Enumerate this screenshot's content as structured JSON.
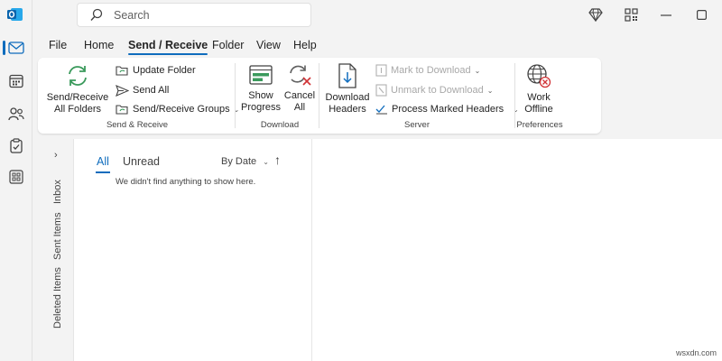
{
  "search": {
    "placeholder": "Search"
  },
  "menu": {
    "tabs": [
      {
        "label": "File"
      },
      {
        "label": "Home"
      },
      {
        "label": "Send / Receive",
        "active": true
      },
      {
        "label": "Folder"
      },
      {
        "label": "View"
      },
      {
        "label": "Help"
      }
    ]
  },
  "ribbon": {
    "send_receive": {
      "all_folders_line1": "Send/Receive",
      "all_folders_line2": "All Folders",
      "update_folder": "Update Folder",
      "send_all": "Send All",
      "groups": "Send/Receive Groups",
      "group_label": "Send & Receive"
    },
    "download": {
      "show_progress_line1": "Show",
      "show_progress_line2": "Progress",
      "cancel_all_line1": "Cancel",
      "cancel_all_line2": "All",
      "group_label": "Download"
    },
    "server": {
      "download_headers_line1": "Download",
      "download_headers_line2": "Headers",
      "mark_to_download": "Mark to Download",
      "unmark_to_download": "Unmark to Download",
      "process_marked_headers": "Process Marked Headers",
      "group_label": "Server"
    },
    "preferences": {
      "work_offline_line1": "Work",
      "work_offline_line2": "Offline",
      "group_label": "Preferences"
    }
  },
  "folders": {
    "inbox": "Inbox",
    "sent": "Sent Items",
    "deleted": "Deleted Items"
  },
  "message_list": {
    "filter_all": "All",
    "filter_unread": "Unread",
    "sort_by": "By Date",
    "sort_arrow": "↑",
    "empty_message": "We didn't find anything to show here."
  },
  "watermark": "wsxdn.com",
  "colors": {
    "accent": "#0f6cbd",
    "chrome": "#f3f3f3",
    "sync_green": "#3b9a5c",
    "error_red": "#d13438"
  }
}
